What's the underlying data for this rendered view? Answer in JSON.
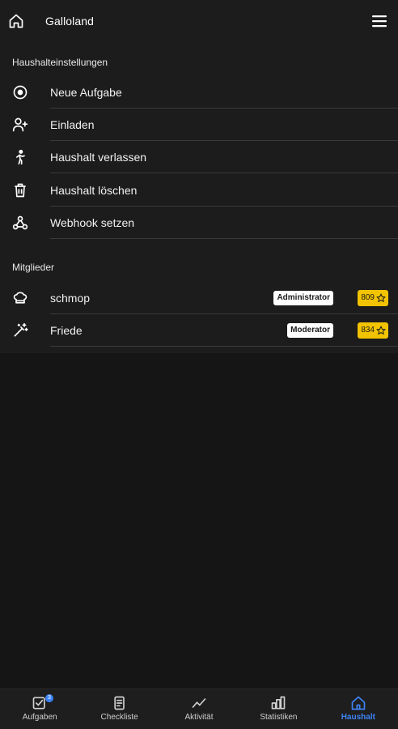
{
  "header": {
    "title": "Galloland",
    "home_icon": "home-icon",
    "menu_icon": "menu-icon"
  },
  "settings": {
    "section_title": "Haushalteinstellungen",
    "items": [
      {
        "label": "Neue Aufgabe",
        "icon": "add-circle-icon"
      },
      {
        "label": "Einladen",
        "icon": "person-add-icon"
      },
      {
        "label": "Haushalt verlassen",
        "icon": "walking-person-icon"
      },
      {
        "label": "Haushalt löschen",
        "icon": "trash-icon"
      },
      {
        "label": "Webhook setzen",
        "icon": "webhook-icon"
      }
    ]
  },
  "members": {
    "section_title": "Mitglieder",
    "items": [
      {
        "name": "schmop",
        "role": "Administrator",
        "points": "809",
        "icon": "chef-hat-icon"
      },
      {
        "name": "Friede",
        "role": "Moderator",
        "points": "834",
        "icon": "magic-wand-icon"
      }
    ]
  },
  "bottom_nav": {
    "items": [
      {
        "label": "Aufgaben",
        "icon": "task-check-icon",
        "badge": "3"
      },
      {
        "label": "Checkliste",
        "icon": "checklist-icon"
      },
      {
        "label": "Aktivität",
        "icon": "activity-icon"
      },
      {
        "label": "Statistiken",
        "icon": "bar-chart-icon"
      },
      {
        "label": "Haushalt",
        "icon": "household-icon",
        "active": true
      }
    ]
  },
  "colors": {
    "accent": "#3d84f5",
    "points_badge": "#f2c300",
    "background": "#151515",
    "panel": "#1c1c1c"
  }
}
